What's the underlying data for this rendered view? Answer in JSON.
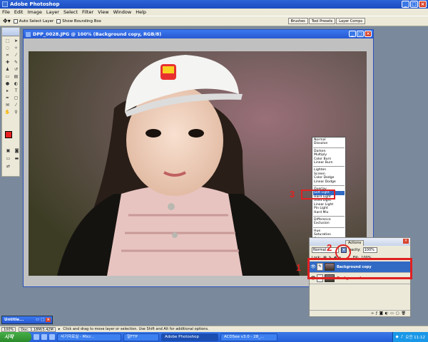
{
  "app": {
    "title": "Adobe Photoshop"
  },
  "menu": [
    "File",
    "Edit",
    "Image",
    "Layer",
    "Select",
    "Filter",
    "View",
    "Window",
    "Help"
  ],
  "options": {
    "auto_select": "Auto Select Layer",
    "bounding": "Show Bounding Box"
  },
  "palette_well": [
    "Brushes",
    "Tool Presets",
    "Layer Comps"
  ],
  "document": {
    "title": "DPP_0028.JPG @ 100% (Background copy, RGB/8)"
  },
  "blend_groups": [
    [
      "Normal",
      "Dissolve"
    ],
    [
      "Darken",
      "Multiply",
      "Color Burn",
      "Linear Burn"
    ],
    [
      "Lighten",
      "Screen",
      "Color Dodge",
      "Linear Dodge"
    ],
    [
      "Overlay",
      "Soft Light",
      "Hard Light",
      "Vivid Light",
      "Linear Light",
      "Pin Light",
      "Hard Mix"
    ],
    [
      "Difference",
      "Exclusion"
    ],
    [
      "Hue",
      "Saturation",
      "Color",
      "Luminosity"
    ]
  ],
  "blend_selected": "Soft Light",
  "annotations": {
    "one": "1",
    "two": "2",
    "three": "3"
  },
  "layers_panel": {
    "tabs": [
      "Actions"
    ],
    "blend_value": "Normal",
    "opacity_label": "pacity:",
    "opacity_value": "100%",
    "lock_label": "Lock:",
    "fill_label": "Fill:",
    "fill_value": "100%",
    "layers": [
      {
        "name": "Background copy",
        "active": true
      },
      {
        "name": "Background",
        "active": false
      }
    ]
  },
  "minimized_doc": "Untitle...",
  "status": {
    "zoom": "100%",
    "doc": "Doc: 1.18M/3.42M",
    "hint": "Click and drag to move layer or selection.  Use Shift and Alt for additional options."
  },
  "taskbar": {
    "start": "시작",
    "tasks": [
      "사기자료실 - Micr...",
      "알FTP",
      "Adobe Photoshop",
      "ACDSee v3.0 - 28_..."
    ],
    "clock": "오전 11:12"
  },
  "colors": {
    "accent": "#316ac5",
    "annotation": "#e02020",
    "foreground": "#e82020"
  },
  "icons": [
    "move-icon",
    "marquee-icon",
    "lasso-icon",
    "crop-icon",
    "brush-icon",
    "eye-icon",
    "close-icon"
  ]
}
